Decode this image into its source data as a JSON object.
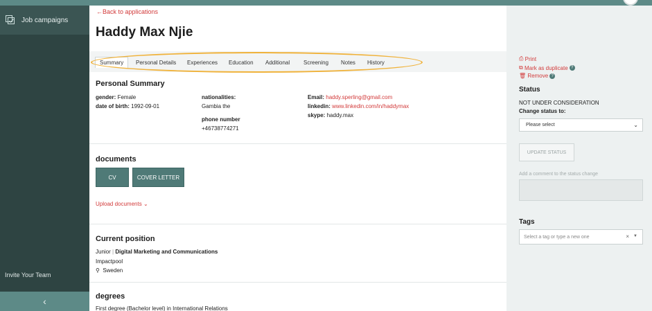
{
  "sidebar": {
    "nav_label": "Job campaigns",
    "invite": "Invite Your Team",
    "collapse_icon": "‹"
  },
  "header": {
    "back": "Back to applications",
    "name": "Haddy Max Njie"
  },
  "tabs": [
    "Summary",
    "Personal Details",
    "Experiences",
    "Education",
    "Additional",
    "Screening",
    "Notes",
    "History"
  ],
  "summary": {
    "title": "Personal Summary",
    "gender_label": "gender:",
    "gender": "Female",
    "dob_label": "date of birth:",
    "dob": "1992-09-01",
    "nat_label": "nationalities:",
    "nat": "Gambia the",
    "phone_label": "phone number",
    "phone": "+46738774271",
    "email_label": "Email:",
    "email": "haddy.sperling@gmail.com",
    "linkedin_label": "linkedin:",
    "linkedin": "www.linkedin.com/in/haddymax",
    "skype_label": "skype:",
    "skype": "haddy.max"
  },
  "documents": {
    "title": "documents",
    "cv": "CV",
    "cover": "COVER LETTER",
    "upload": "Upload documents"
  },
  "position": {
    "title": "Current position",
    "level": "Junior",
    "role": "Digital Marketing and Communications",
    "company": "Impactpool",
    "location": "Sweden"
  },
  "degrees": {
    "title": "degrees",
    "first": "First degree (Bachelor level) in International Relations"
  },
  "right": {
    "print": "Print",
    "duplicate": "Mark as duplicate",
    "remove": "Remove",
    "status_title": "Status",
    "status_value": "NOT UNDER CONSIDERATION",
    "change_label": "Change status to:",
    "select_placeholder": "Please select",
    "update": "UPDATE STATUS",
    "comment_placeholder": "Add a comment to the status change",
    "tags_title": "Tags",
    "tags_placeholder": "Select a tag or type a new one"
  },
  "colors": {
    "accent": "#d23a3a",
    "sidebar": "#2e4442",
    "button": "#4f7a77",
    "highlight": "#f0b23a"
  }
}
